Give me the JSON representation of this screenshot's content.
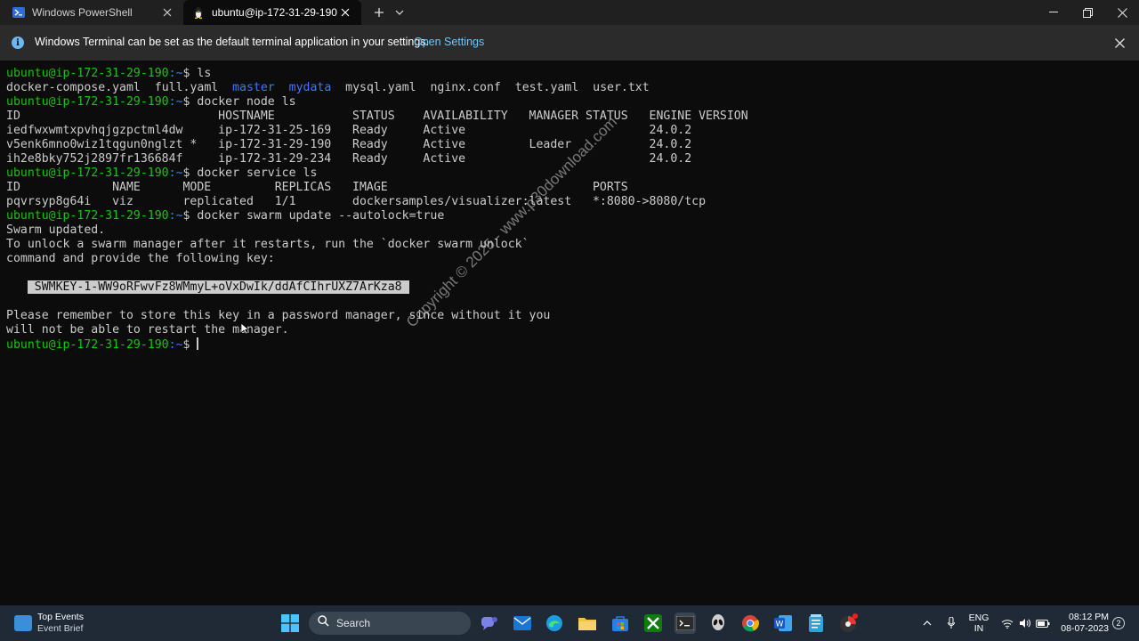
{
  "tabs": [
    {
      "label": "Windows PowerShell",
      "active": false,
      "icon": "powershell-icon"
    },
    {
      "label": "ubuntu@ip-172-31-29-190: ~",
      "active": true,
      "icon": "linux-penguin-icon"
    }
  ],
  "infobar": {
    "message": "Windows Terminal can be set as the default terminal application in your settings.",
    "link": "Open Settings"
  },
  "terminal": {
    "prompt_user": "ubuntu@ip-172-31-29-190",
    "prompt_path": ":~",
    "prompt_symbol": "$ ",
    "cmd_ls": "ls",
    "ls_files": {
      "f1": "docker-compose.yaml",
      "f2": "full.yaml",
      "d1": "master",
      "d2": "mydata",
      "f3": "mysql.yaml",
      "f4": "nginx.conf",
      "f5": "test.yaml",
      "f6": "user.txt"
    },
    "cmd_node_ls": "docker node ls",
    "node_header": "ID                            HOSTNAME           STATUS    AVAILABILITY   MANAGER STATUS   ENGINE VERSION",
    "node_rows": [
      "iedfwxwmtxpvhqjgzpctml4dw     ip-172-31-25-169   Ready     Active                          24.0.2",
      "v5enk6mno0wiz1tqgun0nglzt *   ip-172-31-29-190   Ready     Active         Leader           24.0.2",
      "ih2e8bky752j2897fr136684f     ip-172-31-29-234   Ready     Active                          24.0.2"
    ],
    "cmd_service_ls": "docker service ls",
    "service_header": "ID             NAME      MODE         REPLICAS   IMAGE                             PORTS",
    "service_row": "pqvrsyp8g64i   viz       replicated   1/1        dockersamples/visualizer:latest   *:8080->8080/tcp",
    "cmd_autolock": "docker swarm update --autolock=true",
    "out_lines": [
      "Swarm updated.",
      "To unlock a swarm manager after it restarts, run the `docker swarm unlock`",
      "command and provide the following key:"
    ],
    "key": " SWMKEY-1-WW9oRFwvFz8WMmyL+oVxDwIk/ddAfCIhrUXZ7ArKza8 ",
    "remember_lines": [
      "Please remember to store this key in a password manager, since without it you",
      "will not be able to restart the manager."
    ]
  },
  "watermark": "Copyright © 2025 - www.p30download.com",
  "taskbar": {
    "weather_title": "Top Events",
    "weather_sub": "Event Brief",
    "search_label": "Search",
    "lang_top": "ENG",
    "lang_bottom": "IN",
    "time": "08:12 PM",
    "date": "08-07-2023",
    "notifications": "2"
  },
  "colors": {
    "terminal_bg": "#0c0c0c",
    "prompt_green": "#16c60c",
    "path_blue": "#3b78ff",
    "text": "#cccccc",
    "link": "#6cc8ff",
    "taskbar": "#1f2a36"
  }
}
